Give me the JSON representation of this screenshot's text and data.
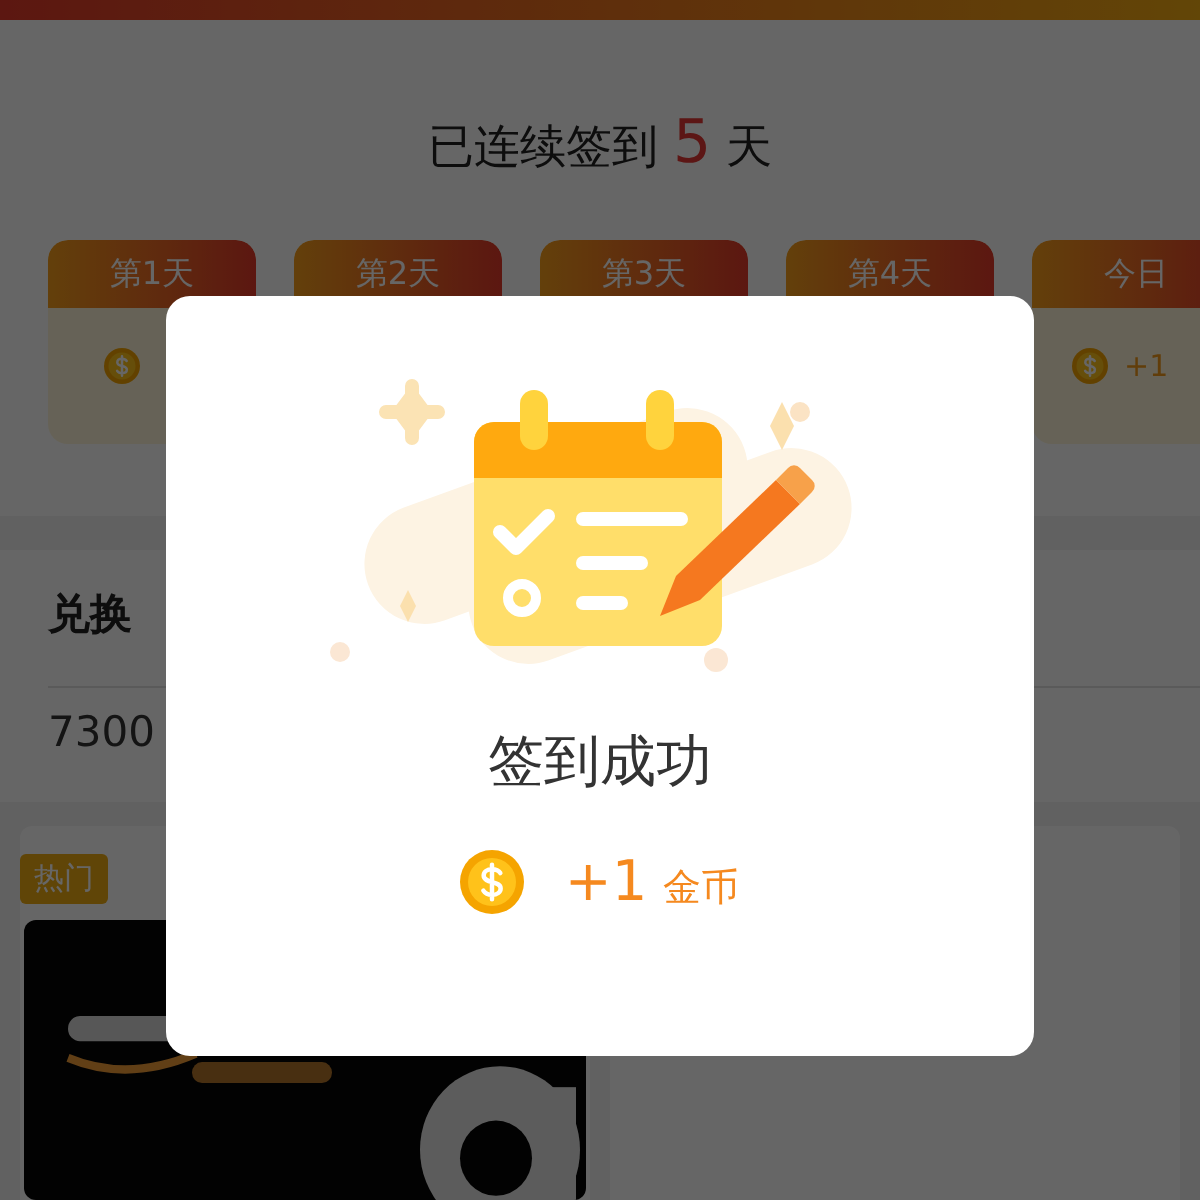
{
  "checkin": {
    "prefix": "已连续签到",
    "count": "5",
    "suffix": "天"
  },
  "days": [
    {
      "label": "第1天",
      "kind": "past"
    },
    {
      "label": "第2天",
      "kind": "covered"
    },
    {
      "label": "第3天",
      "kind": "covered"
    },
    {
      "label": "第4天",
      "kind": "covered"
    },
    {
      "label": "今日",
      "kind": "today",
      "reward": "+1"
    }
  ],
  "exchange": {
    "title": "兑换",
    "balance": "7300"
  },
  "products": [
    {
      "kind": "card",
      "badge": "热门"
    },
    {
      "kind": "empty"
    }
  ],
  "dialog": {
    "title": "签到成功",
    "reward_amount": "+1",
    "reward_unit": "金币"
  }
}
